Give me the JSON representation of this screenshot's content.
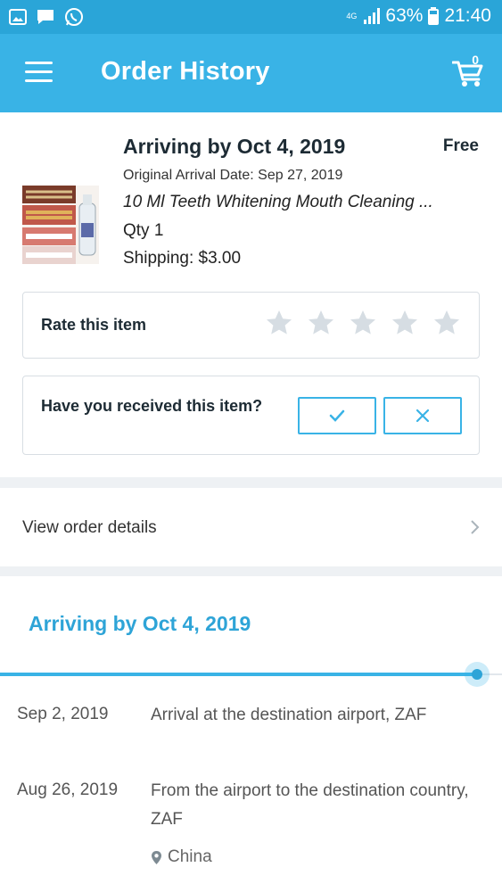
{
  "status_bar": {
    "network": "4G",
    "battery": "63%",
    "time": "21:40",
    "icons": [
      "gallery-icon",
      "message-icon",
      "whatsapp-icon",
      "signal-icon",
      "battery-icon"
    ]
  },
  "header": {
    "title": "Order History",
    "cart_count": "0",
    "icons": [
      "hamburger-menu-icon",
      "cart-icon"
    ]
  },
  "item": {
    "arrival_title": "Arriving by Oct 4, 2019",
    "price": "Free",
    "original_arrival": "Original Arrival Date: Sep 27, 2019",
    "product_name": "10 Ml Teeth Whitening Mouth Cleaning ...",
    "quantity": "Qty 1",
    "shipping": "Shipping: $3.00",
    "rate_label": "Rate this item",
    "rating": 0,
    "rating_max": 5,
    "received_question": "Have you received this item?",
    "star_color": "#d6dde3",
    "accent_color": "#39b3e6"
  },
  "order_details": {
    "label": "View order details"
  },
  "tracking": {
    "title": "Arriving by Oct 4, 2019",
    "progress": 0.95,
    "events": [
      {
        "date": "Sep 2, 2019",
        "description": "Arrival at the destination airport, ZAF"
      },
      {
        "date": "Aug 26, 2019",
        "description": "From the airport to the destination country, ZAF",
        "location": "China"
      }
    ]
  }
}
